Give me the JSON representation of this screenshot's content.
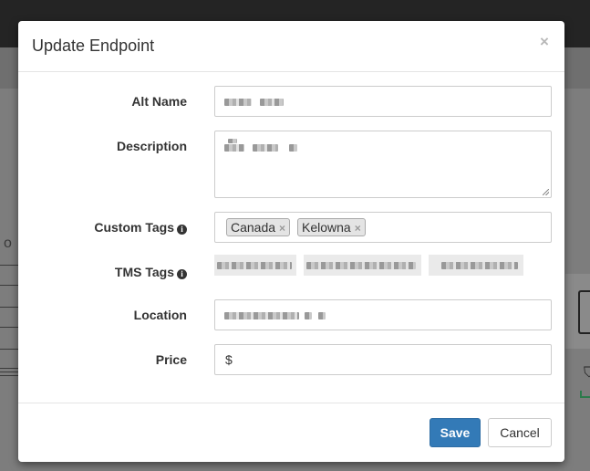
{
  "modal": {
    "title": "Update Endpoint",
    "close_glyph": "×"
  },
  "form": {
    "alt_name_label": "Alt Name",
    "description_label": "Description",
    "custom_tags_label": "Custom Tags",
    "tms_tags_label": "TMS Tags",
    "location_label": "Location",
    "price_label": "Price",
    "info_glyph": "i",
    "custom_tags": [
      {
        "label": "Canada",
        "remove_glyph": "×"
      },
      {
        "label": "Kelowna",
        "remove_glyph": "×"
      }
    ],
    "price_prefix": "$"
  },
  "footer": {
    "save_label": "Save",
    "cancel_label": "Cancel"
  },
  "colors": {
    "primary": "#337ab7",
    "overlay": "#808080",
    "topbar": "#242424"
  },
  "icons": [
    "close-icon",
    "info-icon",
    "tag-remove-icon",
    "resize-grip-icon"
  ]
}
